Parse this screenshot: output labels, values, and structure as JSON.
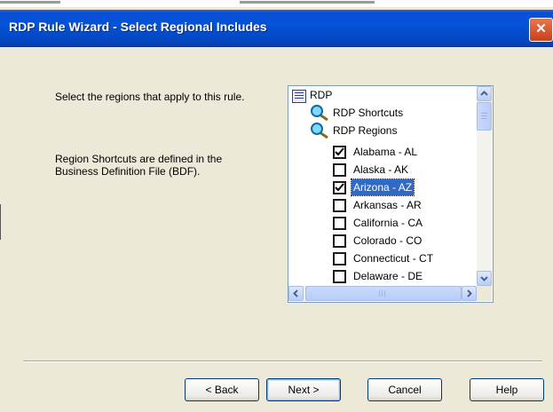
{
  "window": {
    "title": "RDP Rule Wizard - Select Regional Includes",
    "close_glyph": "✕"
  },
  "instructions": {
    "line1": "Select the regions that apply to this rule.",
    "line2": "Region Shortcuts are defined in the Business Definition File (BDF)."
  },
  "tree": {
    "root": {
      "label": "RDP",
      "icon": "list-icon"
    },
    "groups": [
      {
        "label": "RDP Shortcuts",
        "icon": "magnifier-icon"
      },
      {
        "label": "RDP Regions",
        "icon": "magnifier-icon"
      }
    ],
    "regions": [
      {
        "label": "Alabama - AL",
        "checked": true,
        "selected": false
      },
      {
        "label": "Alaska - AK",
        "checked": false,
        "selected": false
      },
      {
        "label": "Arizona - AZ",
        "checked": true,
        "selected": true
      },
      {
        "label": "Arkansas - AR",
        "checked": false,
        "selected": false
      },
      {
        "label": "California - CA",
        "checked": false,
        "selected": false
      },
      {
        "label": "Colorado - CO",
        "checked": false,
        "selected": false
      },
      {
        "label": "Connecticut - CT",
        "checked": false,
        "selected": false
      },
      {
        "label": "Delaware - DE",
        "checked": false,
        "selected": false
      }
    ]
  },
  "buttons": {
    "back": "< Back",
    "next": "Next >",
    "cancel": "Cancel",
    "help": "Help"
  },
  "colors": {
    "titlebar": "#0453d8",
    "dialog_bg": "#ece9d8",
    "selection": "#316ac5",
    "close_button": "#d9552f"
  }
}
